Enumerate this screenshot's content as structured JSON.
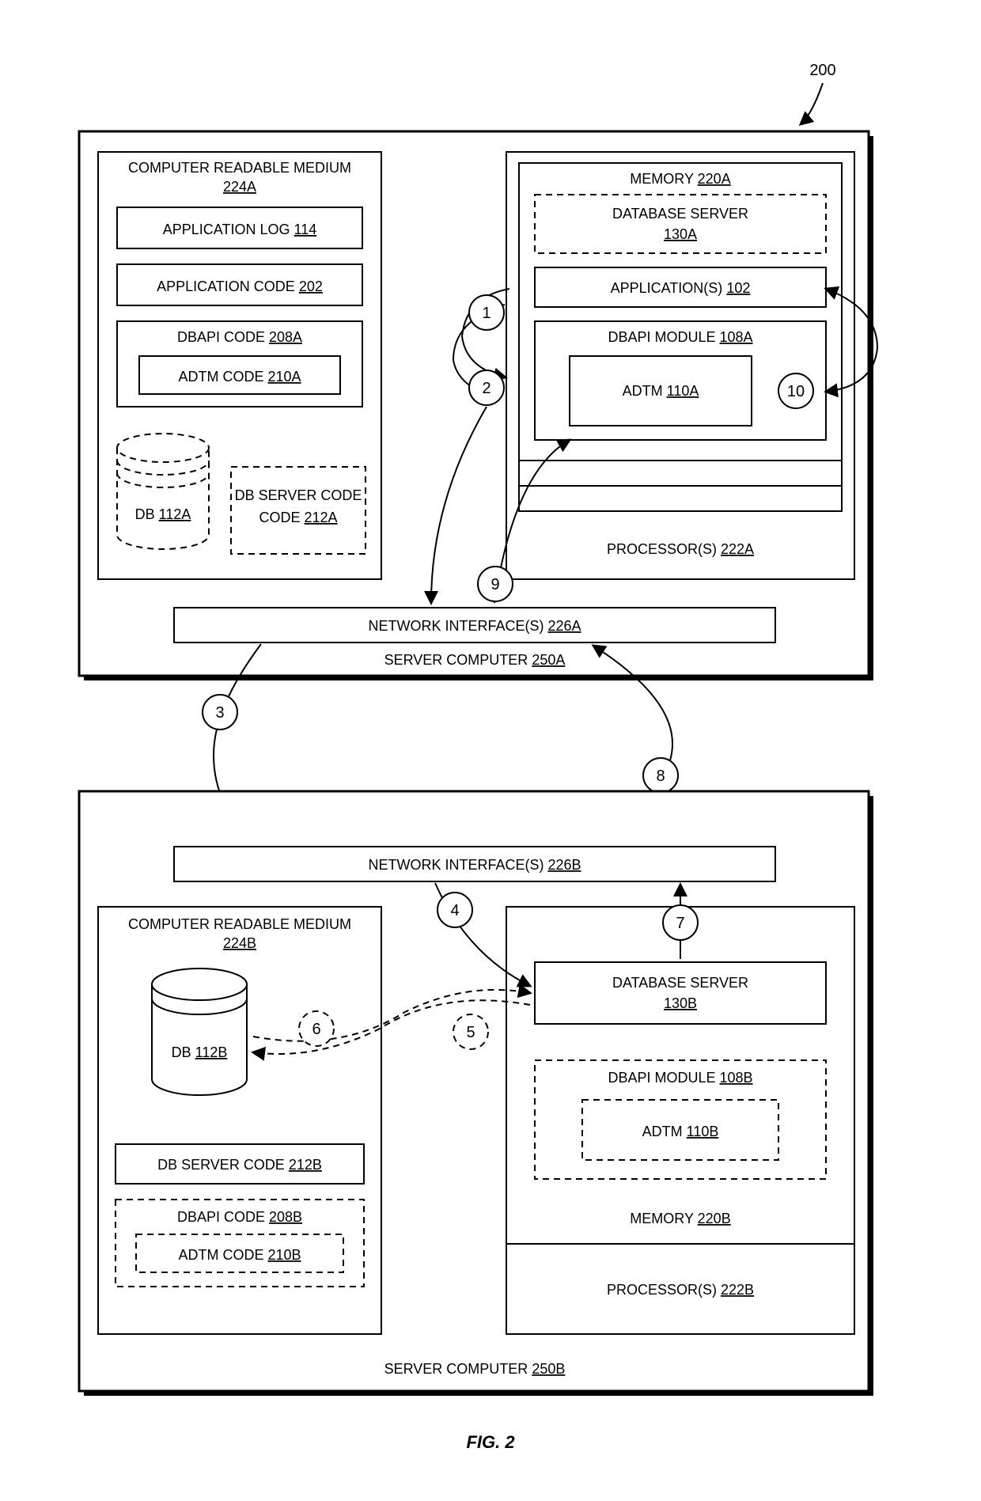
{
  "figure": {
    "label": "FIG. 2",
    "ref": "200"
  },
  "serverA": {
    "title": "SERVER COMPUTER",
    "ref": "250A",
    "netif": {
      "title": "NETWORK INTERFACE(S)",
      "ref": "226A"
    },
    "crm": {
      "title": "COMPUTER READABLE MEDIUM",
      "ref": "224A",
      "appLog": {
        "title": "APPLICATION LOG",
        "ref": "114"
      },
      "appCode": {
        "title": "APPLICATION CODE",
        "ref": "202"
      },
      "dbapiCode": {
        "title": "DBAPI CODE",
        "ref": "208A"
      },
      "adtmCode": {
        "title": "ADTM CODE",
        "ref": "210A"
      },
      "db": {
        "title": "DB",
        "ref": "112A"
      },
      "dbServerCode": {
        "title": "DB SERVER CODE",
        "ref": "212A"
      }
    },
    "mem": {
      "title": "MEMORY",
      "ref": "220A",
      "dbServer": {
        "title": "DATABASE SERVER",
        "ref": "130A"
      },
      "apps": {
        "title": "APPLICATION(S)",
        "ref": "102"
      },
      "dbapiMod": {
        "title": "DBAPI MODULE",
        "ref": "108A"
      },
      "adtm": {
        "title": "ADTM",
        "ref": "110A"
      }
    },
    "proc": {
      "title": "PROCESSOR(S)",
      "ref": "222A"
    }
  },
  "serverB": {
    "title": "SERVER COMPUTER",
    "ref": "250B",
    "netif": {
      "title": "NETWORK INTERFACE(S)",
      "ref": "226B"
    },
    "crm": {
      "title": "COMPUTER READABLE MEDIUM",
      "ref": "224B",
      "db": {
        "title": "DB",
        "ref": "112B"
      },
      "dbServerCode": {
        "title": "DB SERVER CODE",
        "ref": "212B"
      },
      "dbapiCode": {
        "title": "DBAPI CODE",
        "ref": "208B"
      },
      "adtmCode": {
        "title": "ADTM CODE",
        "ref": "210B"
      }
    },
    "mem": {
      "title": "MEMORY",
      "ref": "220B",
      "dbServer": {
        "title": "DATABASE SERVER",
        "ref": "130B"
      },
      "dbapiMod": {
        "title": "DBAPI MODULE",
        "ref": "108B"
      },
      "adtm": {
        "title": "ADTM",
        "ref": "110B"
      }
    },
    "proc": {
      "title": "PROCESSOR(S)",
      "ref": "222B"
    }
  },
  "steps": {
    "n1": "1",
    "n2": "2",
    "n3": "3",
    "n4": "4",
    "n5": "5",
    "n6": "6",
    "n7": "7",
    "n8": "8",
    "n9": "9",
    "n10": "10"
  }
}
